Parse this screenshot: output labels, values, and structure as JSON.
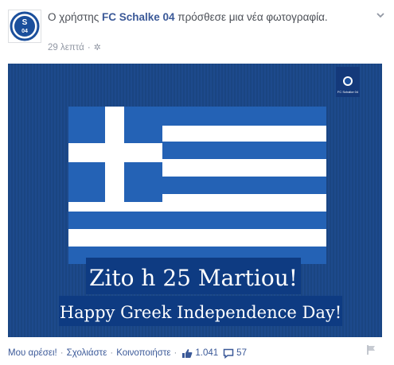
{
  "post": {
    "prefix_text": "Ο χρήστης ",
    "page_name": "FC Schalke 04",
    "suffix_text": " πρόσθεσε μια νέα φωτογραφία.",
    "timestamp": "29 λεπτά",
    "dot": "·",
    "privacy_icon": "gear-icon",
    "menu_icon": "chevron-down-icon",
    "avatar_icon": "schalke-logo"
  },
  "photo": {
    "main_text": "Zito h 25 Martiou!",
    "sub_text": "Happy Greek Independence Day!",
    "corner_logo_text": "FC Schalke 04",
    "colors": {
      "background": "#1d4a8c",
      "flag_blue": "#1f5fb0",
      "flag_white": "#ffffff",
      "caption_box": "#0e3b82"
    }
  },
  "actions": {
    "like": "Μου αρέσει!",
    "comment": "Σχολιάστε",
    "share": "Κοινοποιήστε",
    "separator": "·",
    "like_count": "1.041",
    "comment_count": "57",
    "like_icon": "thumbs-up-icon",
    "comment_icon": "comment-icon",
    "flag_icon": "report-flag-icon"
  }
}
